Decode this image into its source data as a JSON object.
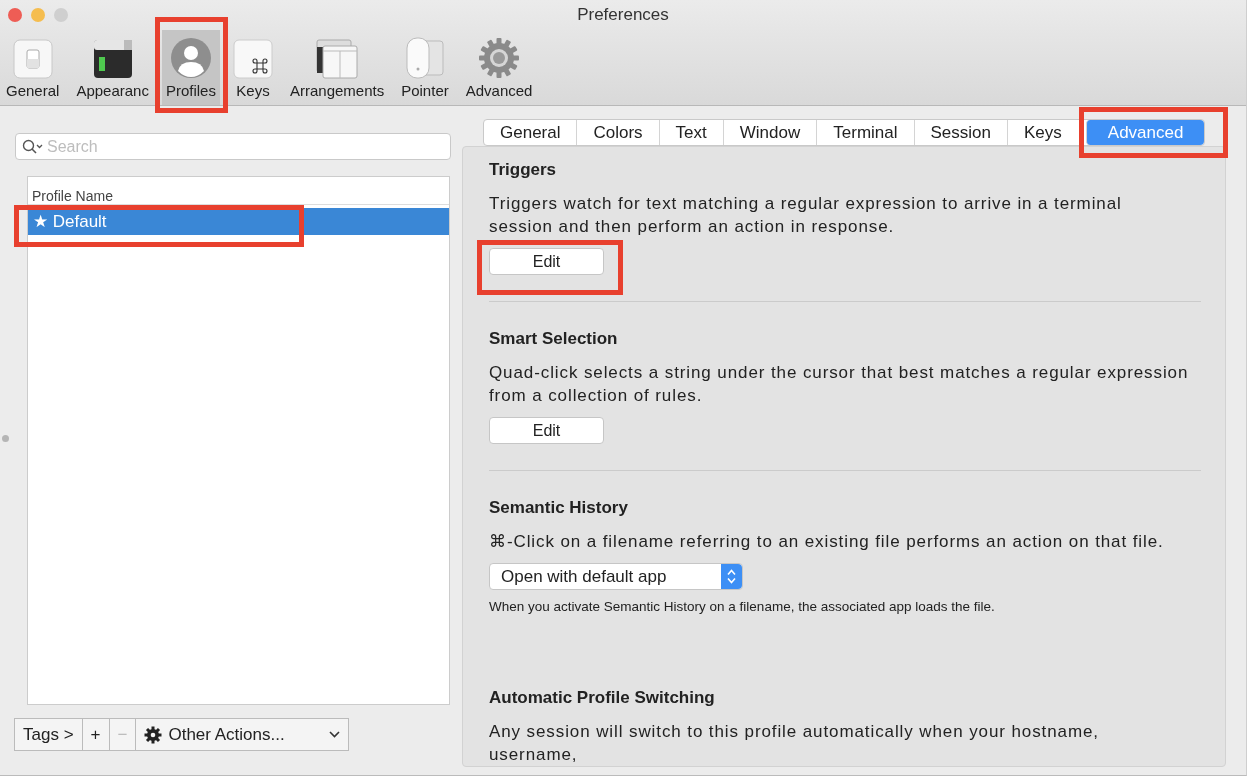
{
  "window": {
    "title": "Preferences"
  },
  "toolbar": [
    {
      "label": "General",
      "selected": false,
      "highlighted": false
    },
    {
      "label": "Appearanc",
      "selected": false,
      "highlighted": false
    },
    {
      "label": "Profiles",
      "selected": true,
      "highlighted": true
    },
    {
      "label": "Keys",
      "selected": false,
      "highlighted": false
    },
    {
      "label": "Arrangements",
      "selected": false,
      "highlighted": false
    },
    {
      "label": "Pointer",
      "selected": false,
      "highlighted": false
    },
    {
      "label": "Advanced",
      "selected": false,
      "highlighted": false
    }
  ],
  "search": {
    "placeholder": "Search"
  },
  "profiles": {
    "column": "Profile Name",
    "rows": [
      {
        "name": "★ Default",
        "selected": true,
        "highlighted": true
      }
    ]
  },
  "bottom_bar": {
    "tags": "Tags >",
    "add": "+",
    "remove": "−",
    "actions": "Other Actions..."
  },
  "tabs": [
    {
      "label": "General",
      "selected": false,
      "highlighted": false
    },
    {
      "label": "Colors",
      "selected": false,
      "highlighted": false
    },
    {
      "label": "Text",
      "selected": false,
      "highlighted": false
    },
    {
      "label": "Window",
      "selected": false,
      "highlighted": false
    },
    {
      "label": "Terminal",
      "selected": false,
      "highlighted": false
    },
    {
      "label": "Session",
      "selected": false,
      "highlighted": false
    },
    {
      "label": "Keys",
      "selected": false,
      "highlighted": false
    },
    {
      "label": "Advanced",
      "selected": true,
      "highlighted": true
    }
  ],
  "sections": [
    {
      "title": "Triggers",
      "description": "Triggers watch for text matching a regular expression to arrive in a terminal session and then perform an action in response.",
      "control": {
        "kind": "button",
        "label": "Edit",
        "highlighted": true
      }
    },
    {
      "title": "Smart Selection",
      "description": "Quad-click selects a string under the cursor that best matches a regular expression from a collection of rules.",
      "control": {
        "kind": "button",
        "label": "Edit",
        "highlighted": false
      }
    },
    {
      "title": "Semantic History",
      "description": "⌘-Click on a filename referring to an existing file performs an action on that file.",
      "control": {
        "kind": "popup",
        "value": "Open with default app"
      },
      "note": "When you activate Semantic History on a filename, the associated app loads the file."
    },
    {
      "title": "Automatic Profile Switching",
      "description": "Any session will switch to this profile automatically when your hostname, username,"
    }
  ]
}
